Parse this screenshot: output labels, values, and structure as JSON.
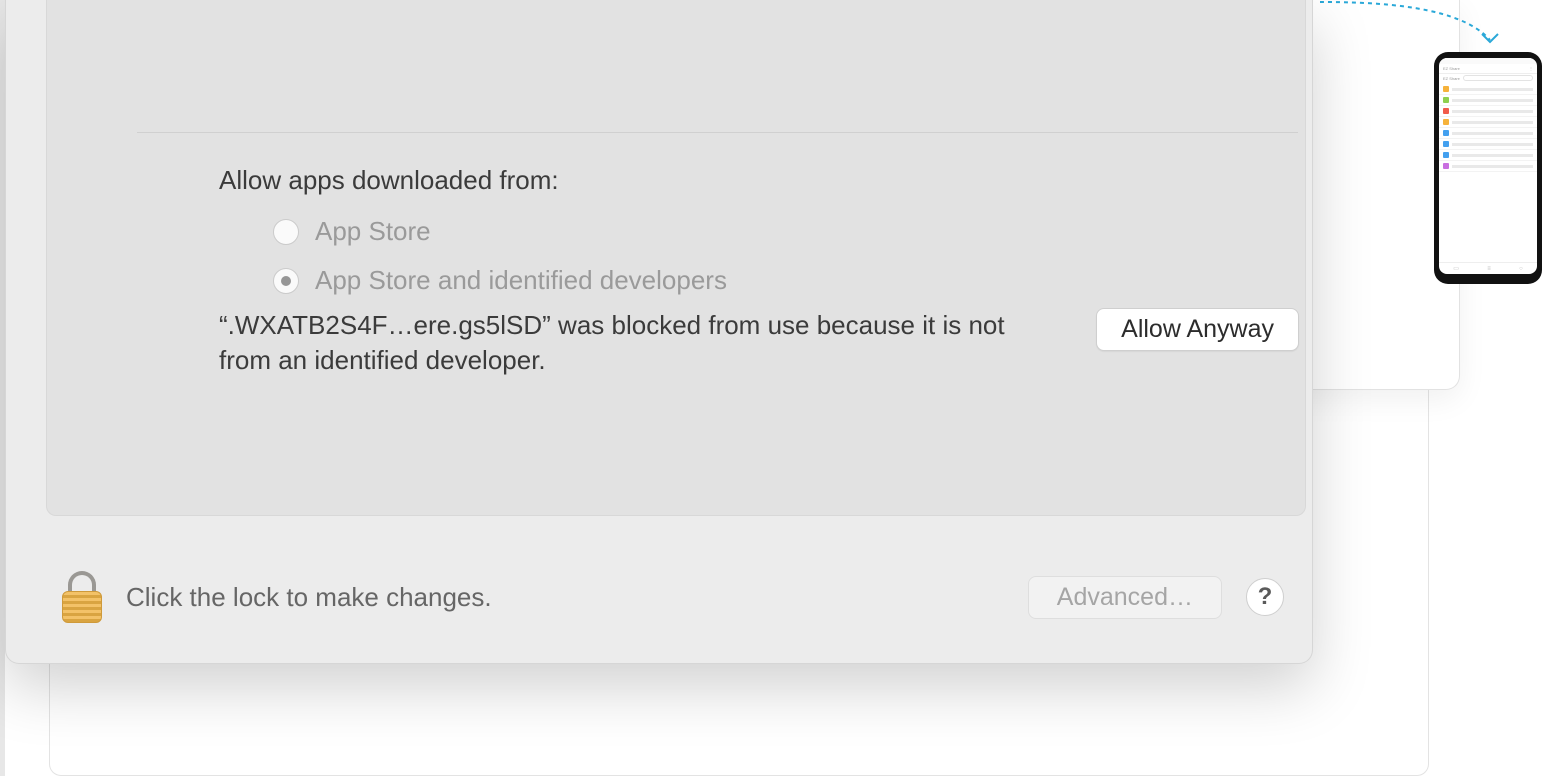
{
  "section_title": "Allow apps downloaded from:",
  "radios": [
    {
      "label": "App Store",
      "selected": false
    },
    {
      "label": "App Store and identified developers",
      "selected": true
    }
  ],
  "blocked_message": "“.WXATB2S4F…ere.gs5lSD” was blocked from use because it is not from an identified developer.",
  "allow_button": "Allow Anyway",
  "footer_text": "Click the lock to make changes.",
  "advanced_button": "Advanced…",
  "help_button": "?",
  "phone": {
    "app_title": "EZ Share",
    "rows": [
      {
        "color": "#f6b23a"
      },
      {
        "color": "#8fd04e"
      },
      {
        "color": "#f15b4a"
      },
      {
        "color": "#f6b23a"
      },
      {
        "color": "#43a0ef"
      },
      {
        "color": "#43a0ef"
      },
      {
        "color": "#43a0ef"
      },
      {
        "color": "#c96fe0"
      }
    ]
  }
}
